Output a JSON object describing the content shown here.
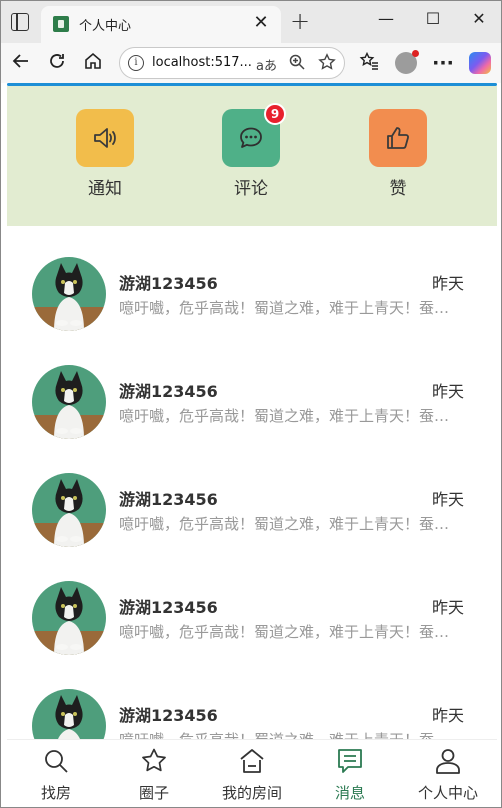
{
  "browser": {
    "tab_title": "个人中心",
    "tab_close": "✕",
    "new_tab": "+",
    "address": "localhost:517...",
    "read_aloud": "aあ",
    "window_min": "—",
    "window_max": "☐",
    "window_close": "✕",
    "more_menu": "···"
  },
  "categories": [
    {
      "label": "通知",
      "icon": "speaker-icon",
      "color": "#f2bd4b"
    },
    {
      "label": "评论",
      "icon": "chat-icon",
      "color": "#4fb088",
      "badge": "9"
    },
    {
      "label": "赞",
      "icon": "thumbs-up-icon",
      "color": "#f28d4f"
    }
  ],
  "messages": [
    {
      "name": "游湖123456",
      "time": "昨天",
      "preview": "噫吁嚱，危乎高哉！蜀道之难，难于上青天！蚕丛及鱼凫"
    },
    {
      "name": "游湖123456",
      "time": "昨天",
      "preview": "噫吁嚱，危乎高哉！蜀道之难，难于上青天！蚕丛及鱼凫"
    },
    {
      "name": "游湖123456",
      "time": "昨天",
      "preview": "噫吁嚱，危乎高哉！蜀道之难，难于上青天！蚕丛及鱼凫"
    },
    {
      "name": "游湖123456",
      "time": "昨天",
      "preview": "噫吁嚱，危乎高哉！蜀道之难，难于上青天！蚕丛及鱼凫"
    },
    {
      "name": "游湖123456",
      "time": "昨天",
      "preview": "噫吁嚱，危乎高哉！蜀道之难，难于上青天！蚕丛及鱼凫"
    }
  ],
  "nav": [
    {
      "label": "找房",
      "icon": "search-icon"
    },
    {
      "label": "圈子",
      "icon": "star-icon"
    },
    {
      "label": "我的房间",
      "icon": "home-icon"
    },
    {
      "label": "消息",
      "icon": "message-icon",
      "active": true
    },
    {
      "label": "个人中心",
      "icon": "user-icon"
    }
  ],
  "colors": {
    "active": "#2b7a52",
    "header_bg": "#e2ecd1",
    "badge": "#e8212d"
  }
}
